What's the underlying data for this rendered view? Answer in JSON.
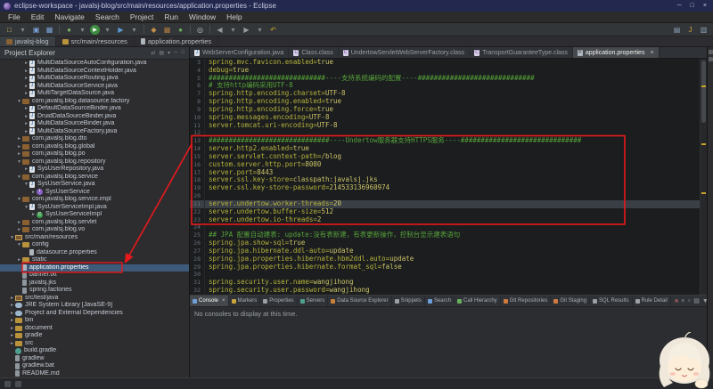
{
  "window": {
    "title": "eclipse-workspace - javalsj-blog/src/main/resources/application.properties - Eclipse",
    "minimize": "─",
    "maximize": "□",
    "close": "×"
  },
  "menubar": {
    "items": [
      "File",
      "Edit",
      "Navigate",
      "Search",
      "Project",
      "Run",
      "Window",
      "Help"
    ]
  },
  "toolbar": {
    "left_icons": [
      {
        "name": "new-wizard",
        "glyph": "□",
        "color": "#d8c06a"
      },
      {
        "name": "new-dropdown",
        "glyph": "▾",
        "color": "#8a8a8a"
      },
      {
        "name": "save",
        "glyph": "▣",
        "color": "#7aa4d8"
      },
      {
        "name": "save-all",
        "glyph": "▦",
        "color": "#7aa4d8"
      },
      {
        "name": "separator"
      },
      {
        "name": "debug",
        "glyph": "●",
        "color": "#7fb069"
      },
      {
        "name": "debug-dropdown",
        "glyph": "▾",
        "color": "#8a8a8a"
      },
      {
        "name": "run",
        "glyph": "▶",
        "color": "#ffffff",
        "bg": "#3e8e41"
      },
      {
        "name": "run-dropdown",
        "glyph": "▾",
        "color": "#8a8a8a"
      },
      {
        "name": "external-tools",
        "glyph": "▶",
        "color": "#5a9bd4"
      },
      {
        "name": "external-tools-dropdown",
        "glyph": "▾",
        "color": "#8a8a8a"
      },
      {
        "name": "separator"
      },
      {
        "name": "new-java-project",
        "glyph": "◆",
        "color": "#c29048"
      },
      {
        "name": "new-package",
        "glyph": "▦",
        "color": "#b07b3e"
      },
      {
        "name": "new-class",
        "glyph": "●",
        "color": "#69b05c"
      },
      {
        "name": "separator"
      },
      {
        "name": "search",
        "glyph": "◎",
        "color": "#bdbdbd"
      },
      {
        "name": "separator"
      },
      {
        "name": "back",
        "glyph": "◀",
        "color": "#9a9a9a"
      },
      {
        "name": "back-dropdown",
        "glyph": "▾",
        "color": "#8a8a8a"
      },
      {
        "name": "forward",
        "glyph": "▶",
        "color": "#9a9a9a"
      },
      {
        "name": "forward-dropdown",
        "glyph": "▾",
        "color": "#8a8a8a"
      },
      {
        "name": "last-edit-location",
        "glyph": "↶",
        "color": "#c9a227"
      }
    ],
    "right_icons": [
      {
        "name": "open-perspective",
        "glyph": "▤",
        "color": "#8fa3b8"
      },
      {
        "name": "java-perspective",
        "glyph": "J",
        "color": "#d8a23a"
      },
      {
        "name": "javaee-perspective",
        "glyph": "▥",
        "color": "#8fa3b8"
      }
    ]
  },
  "breadcrumb": {
    "segments": [
      {
        "label": "javalsj-blog",
        "icon": "project"
      },
      {
        "label": "src/main/resources",
        "icon": "folder"
      },
      {
        "label": "application.properties",
        "icon": "props"
      }
    ]
  },
  "explorer": {
    "title": "Project Explorer",
    "tools": [
      {
        "name": "link-with-editor",
        "glyph": "⇄"
      },
      {
        "name": "collapse-all",
        "glyph": "▤"
      },
      {
        "name": "view-menu",
        "glyph": "▾"
      },
      {
        "name": "minimize-view",
        "glyph": "─"
      },
      {
        "name": "maximize-view",
        "glyph": "□"
      }
    ],
    "tree": [
      {
        "indent": 3,
        "icon": "class",
        "arrow": "c",
        "label": "MultiDataSourceAutoConfiguration.java"
      },
      {
        "indent": 3,
        "icon": "class",
        "arrow": "c",
        "label": "MultiDataSourceContextHolder.java"
      },
      {
        "indent": 3,
        "icon": "class",
        "arrow": "c",
        "label": "MultiDataSourceRouting.java"
      },
      {
        "indent": 3,
        "icon": "class",
        "arrow": "c",
        "label": "MultiDataSourceService.java"
      },
      {
        "indent": 3,
        "icon": "class",
        "arrow": "c",
        "label": "MultiTargetDataSource.java"
      },
      {
        "indent": 2,
        "icon": "pkg",
        "arrow": "e",
        "label": "com.javalsj.blog.datasource.factory"
      },
      {
        "indent": 3,
        "icon": "class",
        "arrow": "c",
        "label": "DefaultDataSourceBinder.java"
      },
      {
        "indent": 3,
        "icon": "class",
        "arrow": "c",
        "label": "DruidDataSourceBinder.java"
      },
      {
        "indent": 3,
        "icon": "class",
        "arrow": "c",
        "label": "MultiDataSourceBinder.java"
      },
      {
        "indent": 3,
        "icon": "class",
        "arrow": "c",
        "label": "MultiDataSourceFactory.java"
      },
      {
        "indent": 2,
        "icon": "pkg",
        "arrow": "c",
        "label": "com.javalsj.blog.dto"
      },
      {
        "indent": 2,
        "icon": "pkg",
        "arrow": "c",
        "label": "com.javalsj.blog.global"
      },
      {
        "indent": 2,
        "icon": "pkg",
        "arrow": "c",
        "label": "com.javalsj.blog.po"
      },
      {
        "indent": 2,
        "icon": "pkg",
        "arrow": "e",
        "label": "com.javalsj.blog.repository"
      },
      {
        "indent": 3,
        "icon": "class",
        "arrow": "c",
        "label": "SysUserRepository.java"
      },
      {
        "indent": 2,
        "icon": "pkg",
        "arrow": "e",
        "label": "com.javalsj.blog.service"
      },
      {
        "indent": 3,
        "icon": "class",
        "arrow": "e",
        "label": "SysUserService.java"
      },
      {
        "indent": 4,
        "icon": "iface",
        "arrow": "c",
        "label": "SysUserService"
      },
      {
        "indent": 2,
        "icon": "pkg",
        "arrow": "e",
        "label": "com.javalsj.blog.service.impl"
      },
      {
        "indent": 3,
        "icon": "class",
        "arrow": "e",
        "label": "SysUserServiceImpl.java"
      },
      {
        "indent": 4,
        "icon": "classg",
        "arrow": "c",
        "label": "SysUserServiceImpl"
      },
      {
        "indent": 2,
        "icon": "pkg",
        "arrow": "c",
        "label": "com.javalsj.blog.servlet"
      },
      {
        "indent": 2,
        "icon": "pkg",
        "arrow": "c",
        "label": "com.javalsj.blog.vo"
      },
      {
        "indent": 1,
        "icon": "src",
        "arrow": "e",
        "label": "src/main/resources"
      },
      {
        "indent": 2,
        "icon": "folder",
        "arrow": "e",
        "label": "config"
      },
      {
        "indent": 3,
        "icon": "props",
        "label": "datasource.properties"
      },
      {
        "indent": 2,
        "icon": "folder",
        "arrow": "c",
        "label": "static"
      },
      {
        "indent": 2,
        "icon": "props",
        "label": "application.properties",
        "selected": true
      },
      {
        "indent": 2,
        "icon": "file",
        "label": "banner.txt"
      },
      {
        "indent": 2,
        "icon": "file",
        "label": "javalsj.jks"
      },
      {
        "indent": 2,
        "icon": "file",
        "label": "spring.factories"
      },
      {
        "indent": 1,
        "icon": "src",
        "arrow": "c",
        "label": "src/test/java"
      },
      {
        "indent": 1,
        "icon": "lib",
        "arrow": "c",
        "label": "JRE System Library [JavaSE-9]"
      },
      {
        "indent": 1,
        "icon": "lib",
        "arrow": "c",
        "label": "Project and External Dependencies"
      },
      {
        "indent": 1,
        "icon": "folder",
        "arrow": "c",
        "label": "bin"
      },
      {
        "indent": 1,
        "icon": "folder",
        "arrow": "c",
        "label": "document"
      },
      {
        "indent": 1,
        "icon": "folder",
        "arrow": "c",
        "label": "gradle"
      },
      {
        "indent": 1,
        "icon": "folder",
        "arrow": "c",
        "label": "src"
      },
      {
        "indent": 1,
        "icon": "gradle",
        "label": "build.gradle"
      },
      {
        "indent": 1,
        "icon": "file",
        "label": "gradlew"
      },
      {
        "indent": 1,
        "icon": "file",
        "label": "gradlew.bat"
      },
      {
        "indent": 1,
        "icon": "file",
        "label": "README.md"
      }
    ]
  },
  "editor": {
    "tabs": [
      {
        "label": "WebServerConfiguration.java",
        "icon": "java"
      },
      {
        "label": "Class.class",
        "icon": "class"
      },
      {
        "label": "UndertowServletWebServerFactory.class",
        "icon": "class"
      },
      {
        "label": "TransportGuaranteeType.class",
        "icon": "class"
      },
      {
        "label": "application.properties",
        "icon": "props",
        "active": true,
        "close": "×"
      }
    ],
    "lines": [
      {
        "n": 3,
        "type": "kv",
        "key": "spring.mvc.favicon.enabled",
        "value": "true"
      },
      {
        "n": 4,
        "type": "kv",
        "key": "debug",
        "value": "true"
      },
      {
        "n": 5,
        "type": "comment",
        "text": "#############################----支持系统编码的配置----#############################"
      },
      {
        "n": 6,
        "type": "comment",
        "text": "# 支持http编码采用UTF-8"
      },
      {
        "n": 7,
        "type": "kv",
        "key": "spring.http.encoding.charset",
        "value": "UTF-8"
      },
      {
        "n": 8,
        "type": "kv",
        "key": "spring.http.encoding.enabled",
        "value": "true"
      },
      {
        "n": 9,
        "type": "kv",
        "key": "spring.http.encoding.force",
        "value": "true"
      },
      {
        "n": 10,
        "type": "kv",
        "key": "spring.messages.encoding",
        "value": "UTF-8"
      },
      {
        "n": 11,
        "type": "kv",
        "key": "server.tomcat.uri-encoding",
        "value": "UTF-8"
      },
      {
        "n": 12,
        "type": "blank"
      },
      {
        "n": 13,
        "type": "comment",
        "text": "##############################----Undertow服务器支持HTTPS服务----##############################"
      },
      {
        "n": 14,
        "type": "kv",
        "key": "server.http2.enabled",
        "value": "true"
      },
      {
        "n": 15,
        "type": "kv",
        "key": "server.servlet.context-path",
        "value": "/blog"
      },
      {
        "n": 16,
        "type": "kv",
        "key": "custom.server.http.port",
        "value": "8080"
      },
      {
        "n": 17,
        "type": "kv",
        "key": "server.port",
        "value": "8443"
      },
      {
        "n": 18,
        "type": "kv",
        "key": "server.ssl.key-store",
        "value": "classpath:javalsj.jks"
      },
      {
        "n": 19,
        "type": "kv",
        "key": "server.ssl.key-store-password",
        "value": "214533136960974"
      },
      {
        "n": 20,
        "type": "blank"
      },
      {
        "n": 21,
        "type": "kv",
        "key": "server.undertow.worker-threads",
        "value": "20",
        "hl": true
      },
      {
        "n": 22,
        "type": "kv",
        "key": "server.undertow.buffer-size",
        "value": "512"
      },
      {
        "n": 23,
        "type": "kv",
        "key": "server.undertow.io-threads",
        "value": "2"
      },
      {
        "n": 24,
        "type": "blank"
      },
      {
        "n": 25,
        "type": "comment",
        "text": "## JPA 配置自动建表: update:没有表新建，有表更新操作，控制台显示建表语句"
      },
      {
        "n": 26,
        "type": "kv",
        "key": "spring.jpa.show-sql",
        "value": "true"
      },
      {
        "n": 27,
        "type": "kv",
        "key": "spring.jpa.hibernate.ddl-auto",
        "value": "update"
      },
      {
        "n": 28,
        "type": "kv",
        "key": "spring.jpa.properties.hibernate.hbm2ddl.auto",
        "value": "update"
      },
      {
        "n": 29,
        "type": "kv",
        "key": "spring.jpa.properties.hibernate.format_sql",
        "value": "false"
      },
      {
        "n": 30,
        "type": "blank"
      },
      {
        "n": 31,
        "type": "kv",
        "key": "spring.security.user.name",
        "value": "wangjihong"
      },
      {
        "n": 32,
        "type": "kv",
        "key": "spring.security.user.password",
        "value": "wangjihong"
      }
    ]
  },
  "console": {
    "tabs": [
      {
        "label": "Console",
        "active": true,
        "close": "×",
        "icon_color": "#6f9fd8"
      },
      {
        "label": "Markers",
        "icon_color": "#c9a43a"
      },
      {
        "label": "Properties",
        "icon_color": "#9aa0a6"
      },
      {
        "label": "Servers",
        "icon_color": "#4e9f8e"
      },
      {
        "label": "Data Source Explorer",
        "icon_color": "#c9803a"
      },
      {
        "label": "Snippets",
        "icon_color": "#9aa0a6"
      },
      {
        "label": "Search",
        "icon_color": "#6f9fd8"
      },
      {
        "label": "Call Hierarchy",
        "icon_color": "#69b05c"
      },
      {
        "label": "Git Repositories",
        "icon_color": "#d07a3f"
      },
      {
        "label": "Git Staging",
        "icon_color": "#d07a3f"
      },
      {
        "label": "SQL Results",
        "icon_color": "#9aa0a6"
      },
      {
        "label": "Rule Detail",
        "icon_color": "#9aa0a6"
      }
    ],
    "toolbar_icons": [
      {
        "name": "terminate",
        "glyph": "■",
        "color": "#8a5555"
      },
      {
        "name": "remove-launch",
        "glyph": "×",
        "color": "#9a9a9a"
      },
      {
        "name": "remove-all-terminated",
        "glyph": "×",
        "color": "#707070"
      },
      {
        "name": "clear-console",
        "glyph": "▤",
        "color": "#9a9a9a"
      },
      {
        "name": "scroll-lock",
        "glyph": "▼",
        "color": "#9a9a9a"
      },
      {
        "name": "word-wrap",
        "glyph": "≡",
        "color": "#9a9a9a"
      },
      {
        "name": "pin-console",
        "glyph": "▣",
        "color": "#9a9a9a"
      },
      {
        "name": "display-selected-console",
        "glyph": "▾",
        "color": "#9a9a9a"
      },
      {
        "name": "open-console",
        "glyph": "□",
        "color": "#9a9a9a"
      },
      {
        "name": "minimize-view",
        "glyph": "▁",
        "color": "#9a9a9a"
      },
      {
        "name": "maximize-view",
        "glyph": "□",
        "color": "#9a9a9a"
      }
    ],
    "message": "No consoles to display at this time."
  },
  "annotation_color": "#e8191c"
}
